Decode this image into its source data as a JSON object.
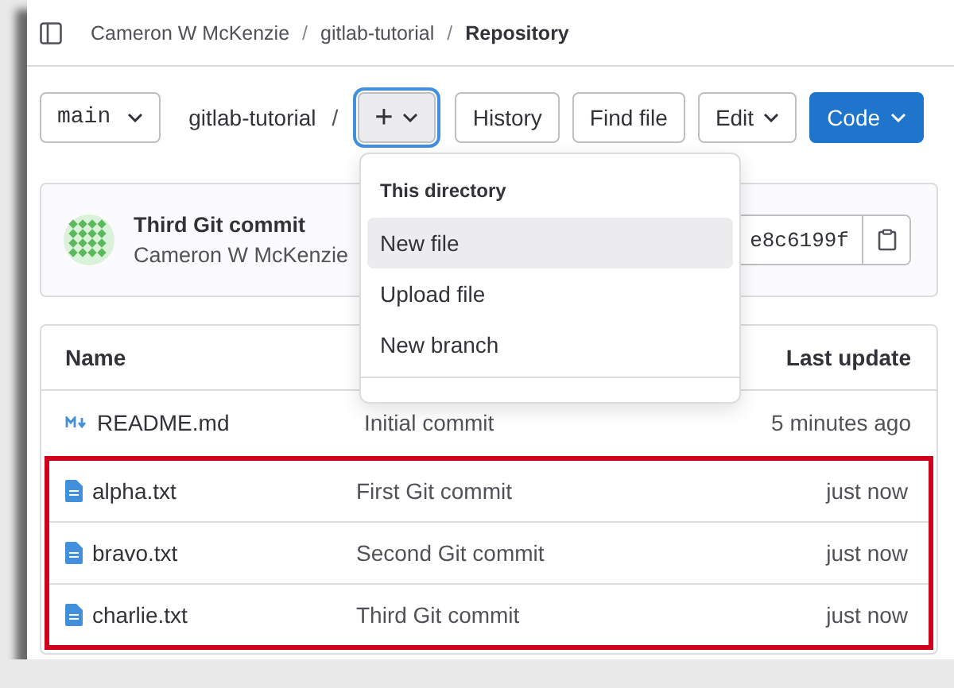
{
  "breadcrumbs": [
    {
      "label": "Cameron W McKenzie",
      "current": false
    },
    {
      "separator": "/",
      "label": "gitlab-tutorial",
      "current": false
    },
    {
      "separator": "/",
      "label": "Repository",
      "current": true
    }
  ],
  "toolbar": {
    "branch": "main",
    "path": "gitlab-tutorial",
    "separator": "/",
    "add_button": "+",
    "buttons": [
      {
        "label": "History",
        "kind": "plain"
      },
      {
        "label": "Find file",
        "kind": "plain"
      },
      {
        "label": "Edit",
        "kind": "menu"
      },
      {
        "label": "Code",
        "kind": "primary"
      }
    ]
  },
  "dropdown": {
    "header": "This directory",
    "items": [
      {
        "label": "New file",
        "selected": true
      },
      {
        "label": "Upload file",
        "selected": false
      },
      {
        "label": "New branch",
        "selected": false
      }
    ]
  },
  "commit": {
    "title": "Third Git commit",
    "author": "Cameron W McKenzie",
    "hash": "e8c6199f"
  },
  "table": {
    "columns": [
      "Name",
      "Last update"
    ],
    "rows": [
      {
        "name": "README.md",
        "kind": "markdown",
        "commit": "Initial commit",
        "updated": "5 minutes ago",
        "highlighted": false
      },
      {
        "name": "alpha.txt",
        "kind": "text",
        "commit": "First Git commit",
        "updated": "just now",
        "highlighted": true
      },
      {
        "name": "bravo.txt",
        "kind": "text",
        "commit": "Second Git commit",
        "updated": "just now",
        "highlighted": true
      },
      {
        "name": "charlie.txt",
        "kind": "text",
        "commit": "Third Git commit",
        "updated": "just now",
        "highlighted": true
      }
    ]
  }
}
